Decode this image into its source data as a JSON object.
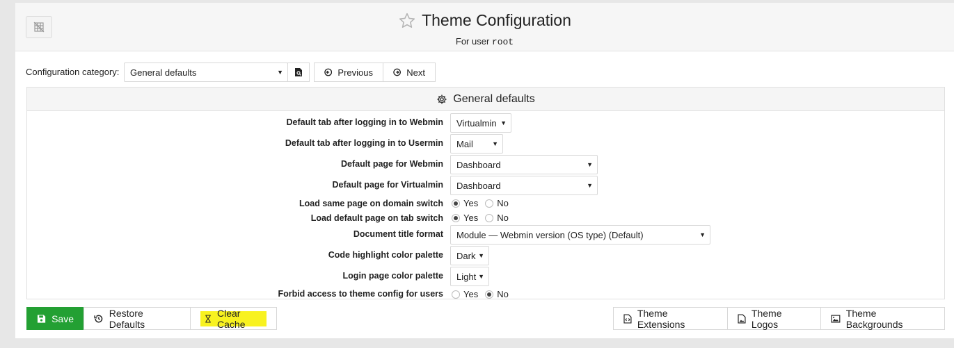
{
  "header": {
    "title": "Theme Configuration",
    "subtitle_prefix": "For user",
    "subtitle_user": "root"
  },
  "nav": {
    "category_label": "Configuration category:",
    "category_value": "General defaults",
    "previous_label": "Previous",
    "next_label": "Next"
  },
  "panel": {
    "title": "General defaults",
    "rows": [
      {
        "label": "Default tab after logging in to Webmin",
        "value": "Virtualmin"
      },
      {
        "label": "Default tab after logging in to Usermin",
        "value": "Mail"
      },
      {
        "label": "Default page for Webmin",
        "value": "Dashboard"
      },
      {
        "label": "Default page for Virtualmin",
        "value": "Dashboard"
      },
      {
        "label": "Load same page on domain switch",
        "yes": "Yes",
        "no": "No",
        "selected": "Yes"
      },
      {
        "label": "Load default page on tab switch",
        "yes": "Yes",
        "no": "No",
        "selected": "Yes"
      },
      {
        "label": "Document title format",
        "value": "Module — Webmin version (OS type) (Default)"
      },
      {
        "label": "Code highlight color palette",
        "value": "Dark"
      },
      {
        "label": "Login page color palette",
        "value": "Light"
      },
      {
        "label": "Forbid access to theme config for users",
        "yes": "Yes",
        "no": "No",
        "selected": "No"
      }
    ]
  },
  "footer": {
    "save_label": "Save",
    "restore_label": "Restore Defaults",
    "clear_cache_label": "Clear Cache",
    "extensions_label": "Theme Extensions",
    "logos_label": "Theme Logos",
    "backgrounds_label": "Theme Backgrounds"
  },
  "colors": {
    "save_green": "#23a033",
    "highlight_yellow": "#f8f220"
  }
}
